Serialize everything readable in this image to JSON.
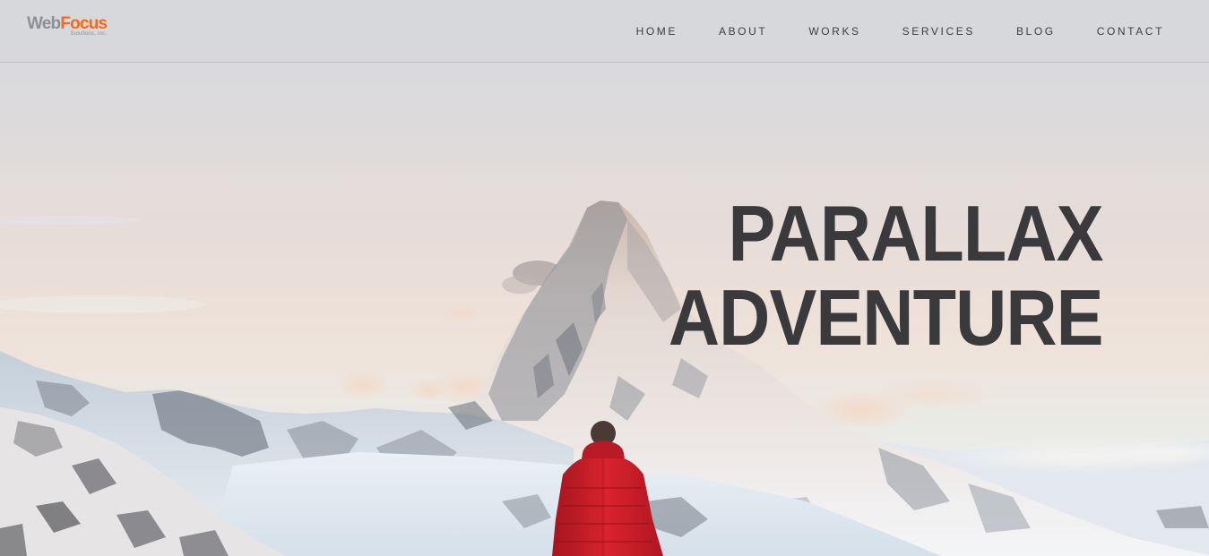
{
  "header": {
    "logo": {
      "word1": "Web",
      "word2": "Focus",
      "tagline": "Solutions, Inc."
    },
    "nav": [
      {
        "label": "HOME"
      },
      {
        "label": "ABOUT"
      },
      {
        "label": "WORKS"
      },
      {
        "label": "SERVICES"
      },
      {
        "label": "BLOG"
      },
      {
        "label": "CONTACT"
      }
    ]
  },
  "hero": {
    "title_line1": "PARALLAX",
    "title_line2": "ADVENTURE",
    "background_image": "snowy-mountain-peak-with-hiker-in-red-jacket"
  },
  "colors": {
    "logo_web": "#8e8f95",
    "logo_focus": "#f26a1b",
    "nav_text": "#3d3e42",
    "headline": "#3a3a3c",
    "jacket": "#d8232e"
  }
}
